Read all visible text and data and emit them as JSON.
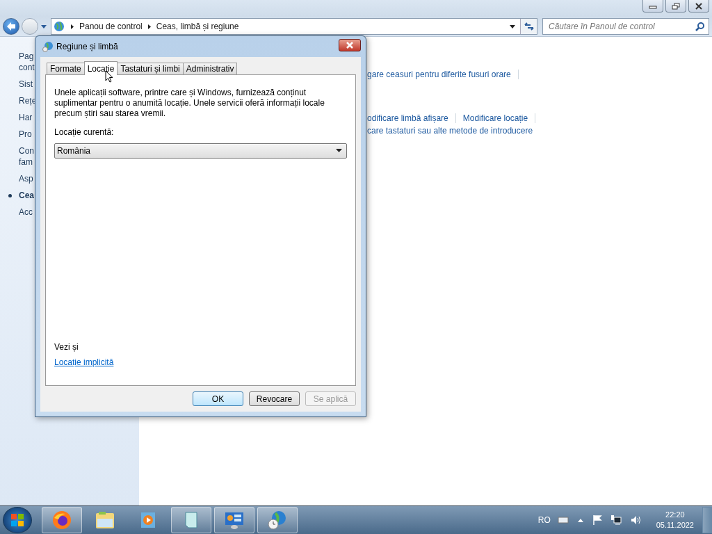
{
  "explorer": {
    "breadcrumbs": [
      "Panou de control",
      "Ceas, limbă și regiune"
    ],
    "search": {
      "placeholder": "Căutare în Panoul de control"
    }
  },
  "sidebar": {
    "items": [
      {
        "lines": [
          "Pag",
          "cont"
        ],
        "selected": false
      },
      {
        "lines": [
          "Sist"
        ],
        "selected": false
      },
      {
        "lines": [
          "Rețe"
        ],
        "selected": false
      },
      {
        "lines": [
          "Har"
        ],
        "selected": false
      },
      {
        "lines": [
          "Pro"
        ],
        "selected": false
      },
      {
        "lines": [
          "Con",
          "fam"
        ],
        "selected": false
      },
      {
        "lines": [
          "Asp"
        ],
        "selected": false
      },
      {
        "lines": [
          "Cea"
        ],
        "selected": true
      },
      {
        "lines": [
          "Acc"
        ],
        "selected": false
      }
    ]
  },
  "content": {
    "rows": [
      {
        "links": [
          {
            "text": "gare ceasuri pentru diferite fusuri orare",
            "separator": true
          }
        ]
      },
      {
        "links": [
          {
            "text": "odificare limbă afișare",
            "separator": true
          },
          {
            "text": "Modificare locație",
            "separator": true
          }
        ]
      },
      {
        "links": [
          {
            "text": "care tastaturi sau alte metode de introducere",
            "separator": false
          }
        ]
      }
    ]
  },
  "dialog": {
    "title": "Regiune și limbă",
    "tabs": [
      {
        "label": "Formate",
        "selected": false
      },
      {
        "label": "Locație",
        "selected": true
      },
      {
        "label": "Tastaturi și limbi",
        "selected": false
      },
      {
        "label": "Administrativ",
        "selected": false
      }
    ],
    "description": "Unele aplicații software, printre care și Windows, furnizează conținut suplimentar pentru o anumită locație. Unele servicii oferă informații locale precum știri sau starea vremii.",
    "location_label": "Locație curentă:",
    "location": {
      "value": "România"
    },
    "see_also": "Vezi și",
    "link": "Locație implicită",
    "buttons": [
      {
        "label": "OK",
        "default": true,
        "disabled": false
      },
      {
        "label": "Revocare",
        "default": false,
        "disabled": false
      },
      {
        "label": "Se aplică",
        "default": false,
        "disabled": true
      }
    ]
  },
  "taskbar": {
    "apps": [
      {
        "kind": "firefox",
        "running": true
      },
      {
        "kind": "folder",
        "running": false
      },
      {
        "kind": "media",
        "running": false
      },
      {
        "kind": "notepad",
        "running": true
      },
      {
        "kind": "control",
        "running": true
      },
      {
        "kind": "globe",
        "running": true
      }
    ],
    "language": "RO",
    "time": "22:20",
    "date": "05.11.2022"
  }
}
